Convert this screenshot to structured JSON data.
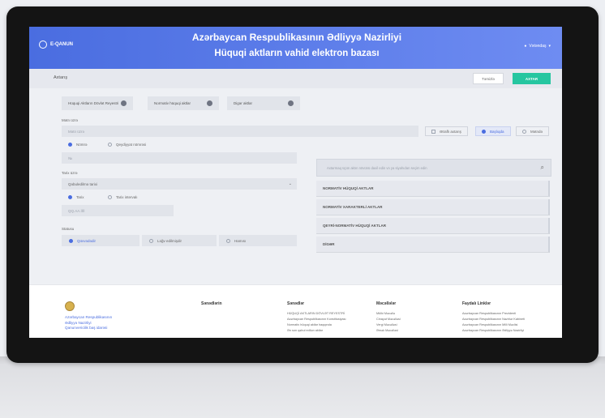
{
  "header": {
    "logo_text": "E-QANUN",
    "title_line1": "Azərbaycan Respublikasının Ədliyyə Nazirliyi",
    "title_line2": "Hüquqi aktların vahid elektron bazası",
    "user_label": "Vətəndaş"
  },
  "toolbar": {
    "breadcrumb": "Axtarış",
    "clear_label": "Təmizlə",
    "search_label": "AXTAR"
  },
  "filters": {
    "pills": [
      "Hüquqi Aktların Dövlət Reyestri",
      "Normativ hüquqi aktlar",
      "Digər aktlar"
    ],
    "text_label": "Mətn üzrə",
    "text_placeholder": "Mətn üzrə",
    "checkbox_label": "Ətraflı axtarış",
    "scope_options": [
      "Başlıqda",
      "Mətndə"
    ],
    "num_radios": [
      "Nömrə",
      "Qeydiyyat nömrəsi"
    ],
    "num_value": "№",
    "date_label": "Tarix üzrə",
    "date_select": "Qəbuledilmə tarixi",
    "date_radios": [
      "Tarix",
      "Tarix intervalı"
    ],
    "date_value": "QQ.AA.İİİİ",
    "status_label": "Statusu",
    "status_options": [
      "Qüvvədədir",
      "Ləğv edilmişdir",
      "Hamısı"
    ]
  },
  "acts": {
    "label": "Aktın növü",
    "search_placeholder": "Axtarmaq üçün aktın növünü daxil edin və ya siyahıdan seçim edin",
    "items": [
      "NORMATİV HÜQUQİ AKTLAR",
      "NORMATİV XARAKTERLİ AKTLAR",
      "QEYRİ-NORMATİV HÜQUQİ AKTLAR",
      "DİGƏR"
    ]
  },
  "footer": {
    "org_line1": "Azərbaycan Respublikasının",
    "org_line2": "Ədliyyə Nazirliyi",
    "org_line3": "Qanunvericilik baş idarəsi",
    "col1_title": "Sənədlərin",
    "col2_title": "Sənədlər",
    "col2_links": [
      "HÜQUQİ AKTLARIN DÖVLƏT REYESTRİ",
      "Azərbaycan Respublikasının Konstitusiyası",
      "Normativ hüquqi aktlar haqqında",
      "Ən son qəbul edilən aktlar"
    ],
    "col3_title": "Məcəllələr",
    "col3_links": [
      "Mülki Məcəllə",
      "Cinayət Məcəlləsi",
      "Vergi Məcəlləsi",
      "Əmək Məcəlləsi"
    ],
    "col4_title": "Faydalı Linklər",
    "col4_links": [
      "Azərbaycan Respublikasının Prezidenti",
      "Azərbaycan Respublikasının Nazirlər Kabineti",
      "Azərbaycan Respublikasının Milli Məclisi",
      "Azərbaycan Respublikasının Ədliyyə Nazirliyi"
    ]
  }
}
